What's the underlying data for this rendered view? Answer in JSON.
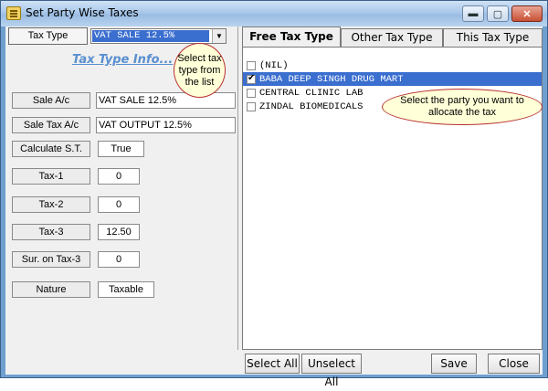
{
  "window": {
    "title": "Set Party Wise Taxes"
  },
  "caption_buttons": {
    "minimize": "▬",
    "maximize": "▢",
    "close": "✕"
  },
  "tax_type": {
    "label": "Tax Type",
    "value": "VAT SALE 12.5%"
  },
  "info_link": "Tax Type Info...",
  "callouts": {
    "tax_type": "Select tax type from the list",
    "party": "Select the party you want to allocate the tax"
  },
  "fields": [
    {
      "label": "Sale A/c",
      "value": "VAT SALE 12.5%"
    },
    {
      "label": "Sale Tax A/c",
      "value": "VAT OUTPUT 12.5%"
    },
    {
      "label": "Calculate S.T.",
      "value": "True"
    },
    {
      "label": "Tax-1",
      "value": "0"
    },
    {
      "label": "Tax-2",
      "value": "0"
    },
    {
      "label": "Tax-3",
      "value": "12.50"
    },
    {
      "label": "Sur. on Tax-3",
      "value": "0"
    },
    {
      "label": "Nature",
      "value": "Taxable"
    }
  ],
  "tabs": [
    {
      "label": "Free Tax Type",
      "active": true
    },
    {
      "label": "Other Tax Type",
      "active": false
    },
    {
      "label": "This Tax Type",
      "active": false
    }
  ],
  "parties": [
    {
      "name": "(NIL)",
      "checked": false,
      "selected": false
    },
    {
      "name": "BABA DEEP SINGH DRUG MART",
      "checked": true,
      "selected": true
    },
    {
      "name": "CENTRAL CLINIC LAB",
      "checked": false,
      "selected": false
    },
    {
      "name": "ZINDAL BIOMEDICALS",
      "checked": false,
      "selected": false
    }
  ],
  "buttons": {
    "select_all": "Select All",
    "unselect_all": "Unselect All",
    "save": "Save",
    "close": "Close"
  }
}
